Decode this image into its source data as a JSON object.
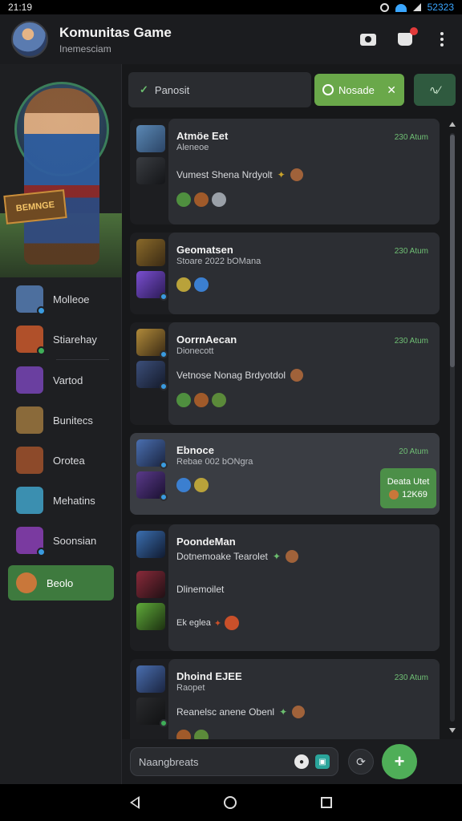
{
  "status_bar": {
    "time": "21:19",
    "battery": "52323"
  },
  "app_bar": {
    "title": "Komunitas Game",
    "subtitle": "Inemesciam"
  },
  "hero": {
    "sign_text": "BEMNGE"
  },
  "sidebar": {
    "items": [
      {
        "label": "Molleoe",
        "icon": "hero-icon",
        "color": "#4d6f9e"
      },
      {
        "label": "Stiarehay",
        "icon": "fire-icon",
        "color": "#b0502a"
      },
      {
        "label": "Vartod",
        "icon": "crystal-icon",
        "color": "#6a3fa0"
      },
      {
        "label": "Bunitecs",
        "icon": "warrior-icon",
        "color": "#8a6a3a"
      },
      {
        "label": "Orotea",
        "icon": "shield-icon",
        "color": "#8d4a2a"
      },
      {
        "label": "Mehatins",
        "icon": "ice-icon",
        "color": "#3b8fb0"
      },
      {
        "label": "Soonsian",
        "icon": "magic-icon",
        "color": "#7a3aa0"
      },
      {
        "label": "Beolo",
        "icon": "avatar-icon",
        "color": "#c9773a"
      }
    ]
  },
  "filters": {
    "chip1": "Panosit",
    "chip2": "Nosade",
    "chip3": "∿⁄"
  },
  "feed": [
    {
      "name": "Atmöe Eet",
      "sub": "Aleneoe",
      "time": "230 Atum",
      "message": "Vumest Shena Nrdyolt",
      "reactions": [
        "#4f8f3f",
        "#a05a2a",
        "#9aa0a8"
      ]
    },
    {
      "name": "Geomatsen",
      "sub": "Stoare 2022 bOMana",
      "time": "230 Atum",
      "message": "",
      "reactions": [
        "#b9a23a",
        "#3b7fd0"
      ]
    },
    {
      "name": "OorrnAecan",
      "sub": "Dionecott",
      "time": "230 Atum",
      "message": "Vetnose Nonag Brdyotdol",
      "reactions": [
        "#4f8f3f",
        "#a05a2a",
        "#5b8a3a"
      ]
    },
    {
      "name": "Ebnoce",
      "sub": "Rebae 002 bONgra",
      "time": "20 Atum",
      "message": "",
      "reactions": [
        "#3b7fd0",
        "#b9a23a"
      ],
      "badge_line1": "Deata Utet",
      "badge_line2": "12K69"
    },
    {
      "name": "PoondeMan",
      "sub": "Dotnemoake Tearolet",
      "time": "",
      "message": "Dlinemoilet",
      "reactions_text": "Ek eglea"
    },
    {
      "name": "Dhoind EJEE",
      "sub": "Raopet",
      "time": "230 Atum",
      "message": "Reanelsc anene Obenl",
      "reactions": [
        "#a05a2a",
        "#5b8a3a"
      ]
    }
  ],
  "composer": {
    "placeholder": "Naangbreats",
    "button_icon": "+"
  }
}
